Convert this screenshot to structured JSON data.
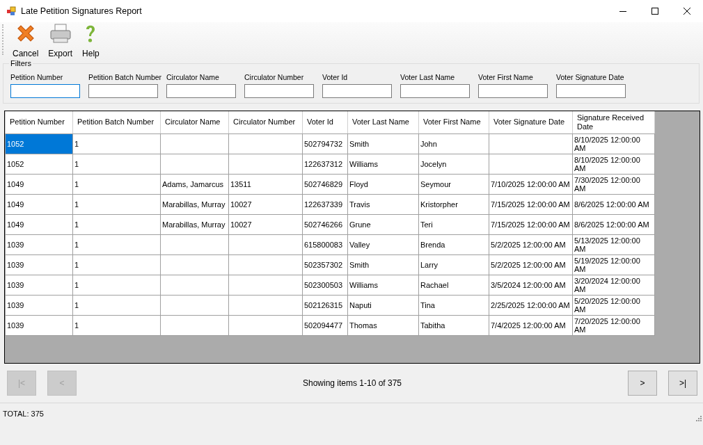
{
  "window": {
    "title": "Late Petition Signatures Report"
  },
  "toolbar": [
    {
      "kind": "cancel",
      "label": "Cancel"
    },
    {
      "kind": "export",
      "label": "Export"
    },
    {
      "kind": "help",
      "label": "Help"
    }
  ],
  "filters": {
    "title": "Filters",
    "fields": [
      {
        "label": "Petition Number",
        "focused": true
      },
      {
        "label": "Petition Batch Number",
        "focused": false
      },
      {
        "label": "Circulator Name",
        "focused": false
      },
      {
        "label": "Circulator Number",
        "focused": false
      },
      {
        "label": "Voter Id",
        "focused": false
      },
      {
        "label": "Voter Last Name",
        "focused": false
      },
      {
        "label": "Voter First Name",
        "focused": false
      },
      {
        "label": "Voter Signature Date",
        "focused": false
      }
    ]
  },
  "table": {
    "columns": [
      "Petition Number",
      "Petition Batch Number",
      "Circulator Name",
      "Circulator Number",
      "Voter Id",
      "Voter Last Name",
      "Voter First Name",
      "Voter Signature Date",
      "Signature Received Date"
    ],
    "rows": [
      {
        "selected": true,
        "cells": [
          "1052",
          "1",
          "",
          "",
          "502794732",
          "Smith",
          "John",
          "",
          "8/10/2025 12:00:00 AM"
        ]
      },
      {
        "selected": false,
        "cells": [
          "1052",
          "1",
          "",
          "",
          "122637312",
          "Williams",
          "Jocelyn",
          "",
          "8/10/2025 12:00:00 AM"
        ]
      },
      {
        "selected": false,
        "cells": [
          "1049",
          "1",
          "Adams, Jamarcus",
          "13511",
          "502746829",
          "Floyd",
          "Seymour",
          "7/10/2025 12:00:00 AM",
          "7/30/2025 12:00:00 AM"
        ]
      },
      {
        "selected": false,
        "cells": [
          "1049",
          "1",
          "Marabillas, Murray",
          "10027",
          "122637339",
          "Travis",
          "Kristorpher",
          "7/15/2025 12:00:00 AM",
          "8/6/2025 12:00:00 AM"
        ]
      },
      {
        "selected": false,
        "cells": [
          "1049",
          "1",
          "Marabillas, Murray",
          "10027",
          "502746266",
          "Grune",
          "Teri",
          "7/15/2025 12:00:00 AM",
          "8/6/2025 12:00:00 AM"
        ]
      },
      {
        "selected": false,
        "cells": [
          "1039",
          "1",
          "",
          "",
          "615800083",
          "Valley",
          "Brenda",
          "5/2/2025 12:00:00 AM",
          "5/13/2025 12:00:00 AM"
        ]
      },
      {
        "selected": false,
        "cells": [
          "1039",
          "1",
          "",
          "",
          "502357302",
          "Smith",
          "Larry",
          "5/2/2025 12:00:00 AM",
          "5/19/2025 12:00:00 AM"
        ]
      },
      {
        "selected": false,
        "cells": [
          "1039",
          "1",
          "",
          "",
          "502300503",
          "Williams",
          "Rachael",
          "3/5/2024 12:00:00 AM",
          "3/20/2024 12:00:00 AM"
        ]
      },
      {
        "selected": false,
        "cells": [
          "1039",
          "1",
          "",
          "",
          "502126315",
          "Naputi",
          "Tina",
          "2/25/2025 12:00:00 AM",
          "5/20/2025 12:00:00 AM"
        ]
      },
      {
        "selected": false,
        "cells": [
          "1039",
          "1",
          "",
          "",
          "502094477",
          "Thomas",
          "Tabitha",
          "7/4/2025 12:00:00 AM",
          "7/20/2025 12:00:00 AM"
        ]
      }
    ]
  },
  "pager": {
    "left": [
      {
        "label": "|<",
        "disabled": true
      },
      {
        "label": "<",
        "disabled": true
      }
    ],
    "info": "Showing items 1-10 of 375",
    "right": [
      {
        "label": ">",
        "disabled": false
      },
      {
        "label": ">|",
        "disabled": false
      }
    ]
  },
  "status_bar": {
    "text": "TOTAL: 375"
  }
}
